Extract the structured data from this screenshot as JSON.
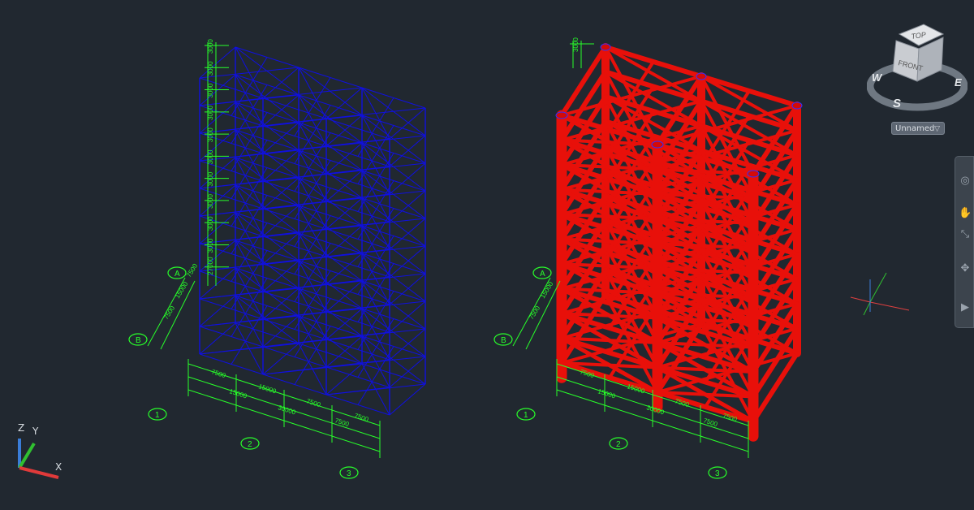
{
  "viewcube": {
    "top_label": "TOP",
    "front_label": "FRONT",
    "compass": {
      "north": "W",
      "east": "E",
      "south": "S"
    }
  },
  "view_name": "Unnamed",
  "ucs": {
    "x": "X",
    "y": "Y",
    "z": "Z"
  },
  "colors": {
    "background": "#212830",
    "dimension": "#28ff2a",
    "wireframe": "#1010e0",
    "solid": "#e8100a"
  },
  "left_model": {
    "grid_labels": [
      "A",
      "B",
      "1",
      "2",
      "3"
    ],
    "bottom_dims": [
      "7500",
      "15000",
      "7500",
      "7500",
      "15000",
      "30000",
      "7500"
    ],
    "side_dims": [
      "7500",
      "15000",
      "7500"
    ],
    "height_dims": [
      "3000",
      "3000",
      "3000",
      "3000",
      "3000",
      "3000",
      "3000",
      "3000",
      "3000",
      "3000",
      "27000"
    ]
  },
  "right_model": {
    "grid_labels": [
      "A",
      "B",
      "1",
      "2",
      "3"
    ],
    "bottom_dims": [
      "7500",
      "15000",
      "7500",
      "7500",
      "15000",
      "30000",
      "7500"
    ],
    "side_dims": [
      "7500",
      "15000"
    ],
    "height_dims": [
      "3000"
    ]
  },
  "nav_icons": [
    "steering-wheel-icon",
    "pan-icon",
    "zoom-icon",
    "orbit-icon",
    "showmotion-icon"
  ]
}
